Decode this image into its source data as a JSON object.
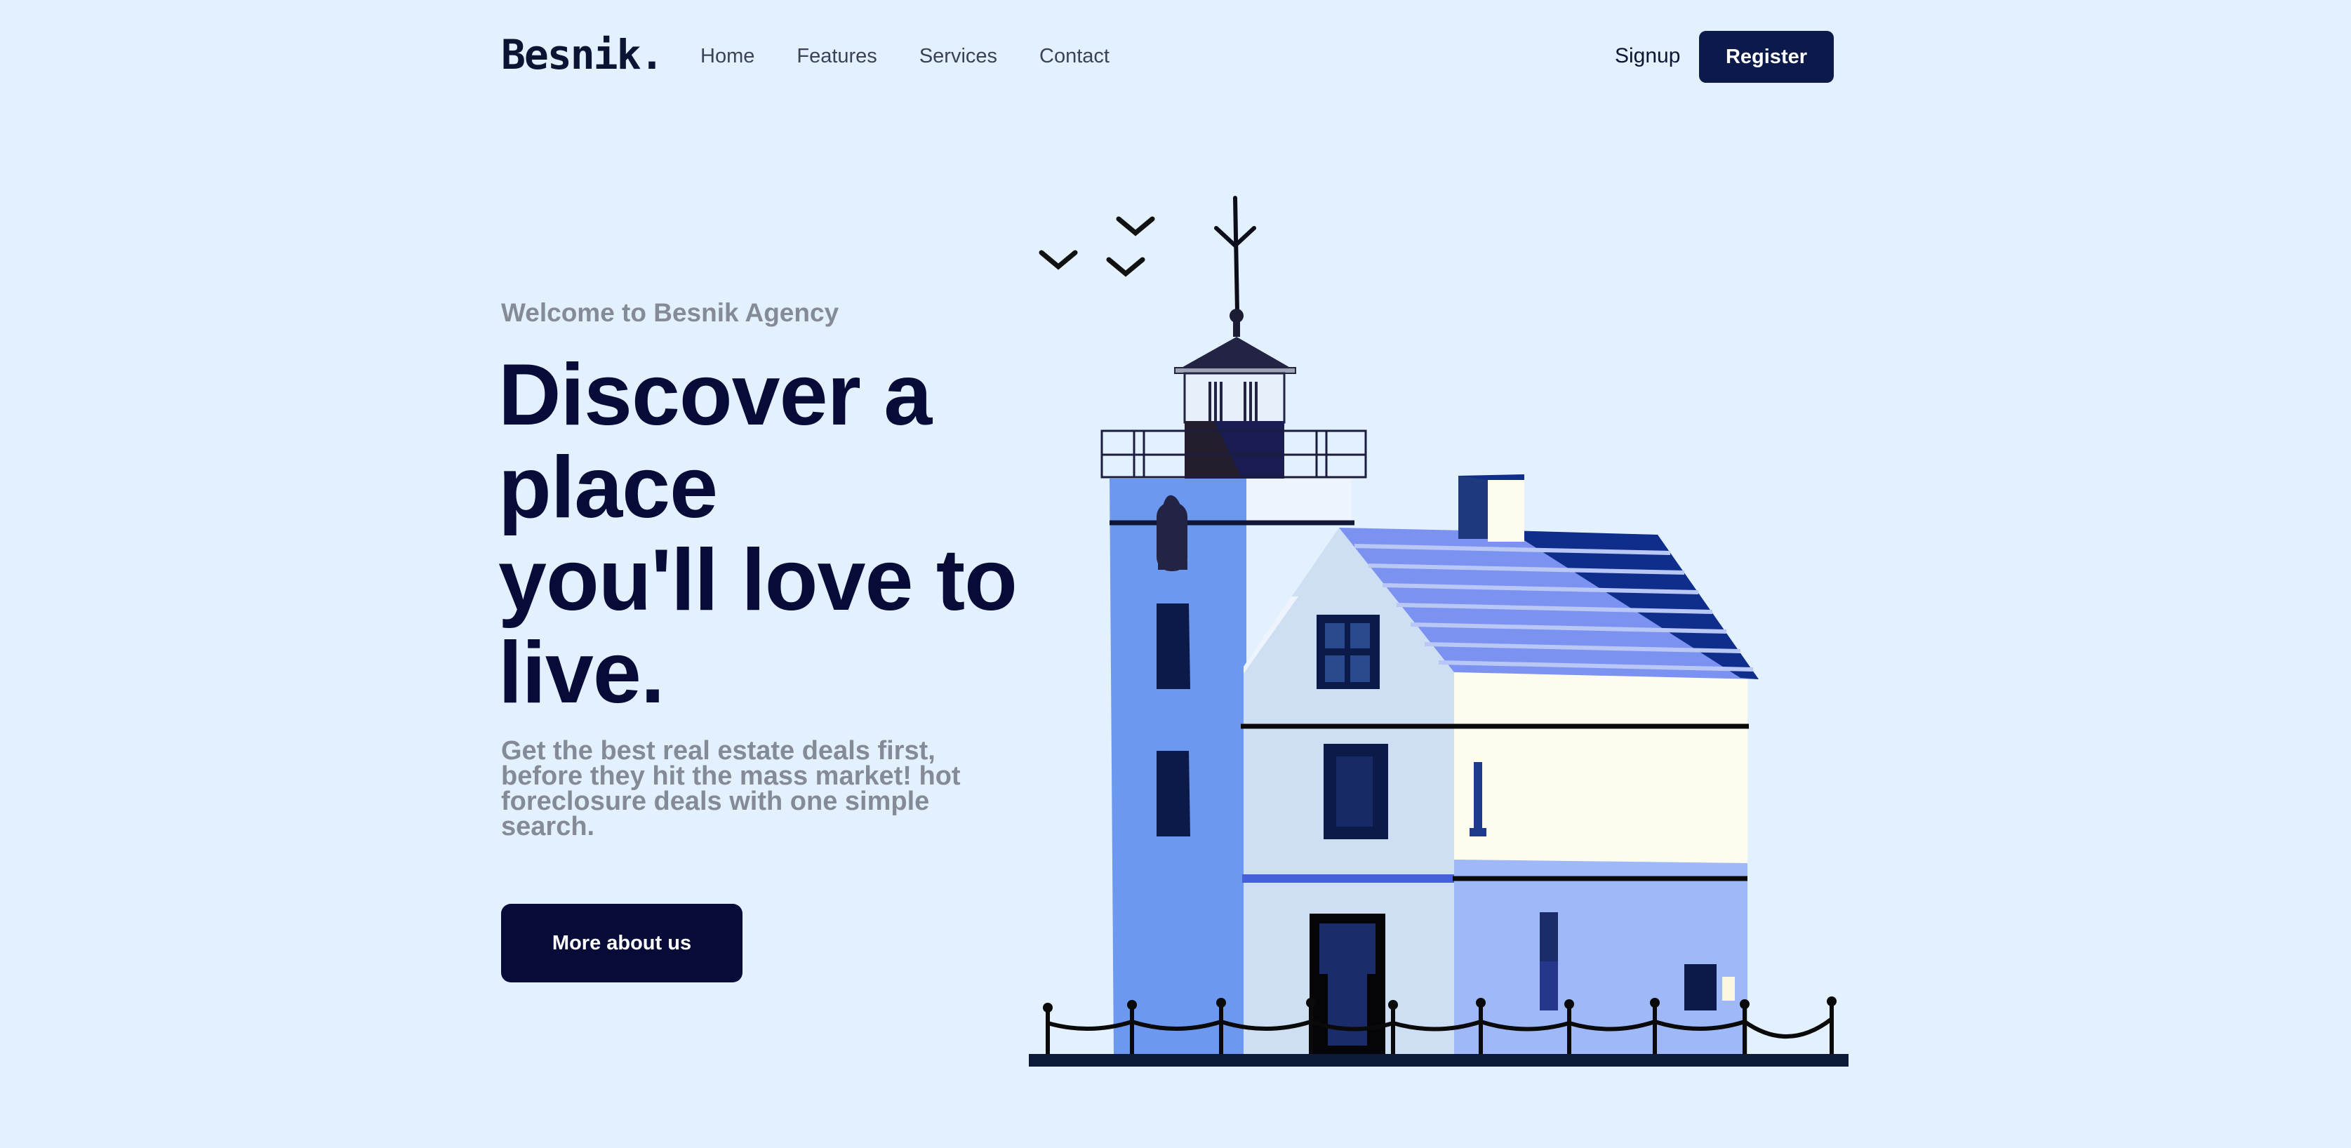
{
  "header": {
    "logo": "Besnik.",
    "nav": [
      "Home",
      "Features",
      "Services",
      "Contact"
    ],
    "signup_label": "Signup",
    "register_label": "Register"
  },
  "hero": {
    "kicker": "Welcome to Besnik Agency",
    "headline_lines": [
      "Discover a",
      "place",
      "you'll love to",
      "live."
    ],
    "subtext": "Get the best real estate deals first, before they hit the mass market! hot foreclosure deals with one simple search.",
    "cta_label": "More about us"
  },
  "colors": {
    "background": "#e3f0fe",
    "primary_dark": "#060b37",
    "button": "#0b1a4a",
    "muted_text": "#848b97"
  },
  "illustration": {
    "subject": "lighthouse-house"
  }
}
